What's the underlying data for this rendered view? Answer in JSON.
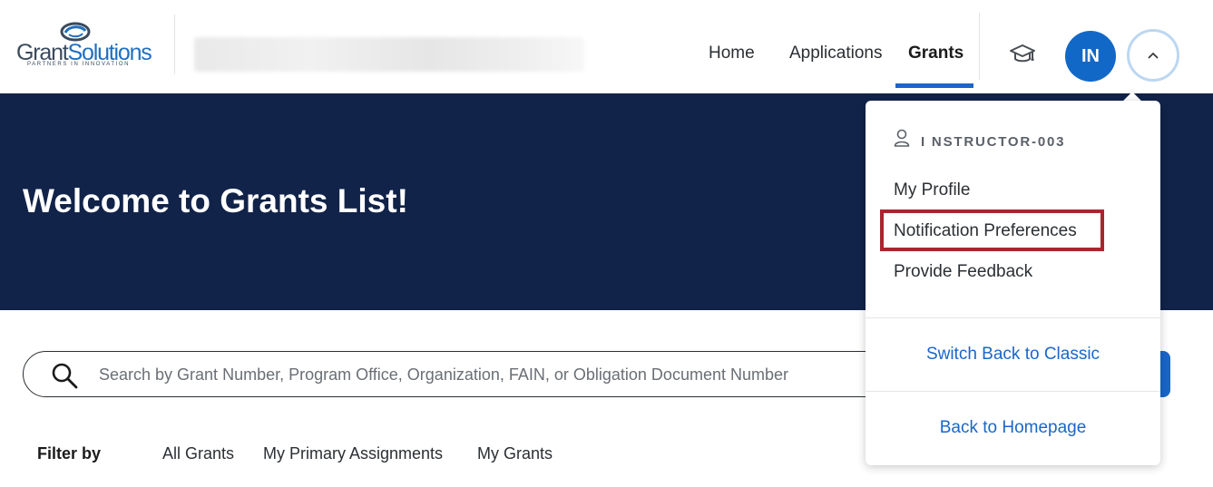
{
  "brand": {
    "logo_part1": "Grant",
    "logo_part2": "Solutions",
    "logo_tagline": "PARTNERS IN INNOVATION",
    "accent_color": "#1a66c9",
    "hero_color": "#112349"
  },
  "nav": {
    "items": [
      {
        "label": "Home"
      },
      {
        "label": "Applications"
      },
      {
        "label": "Grants",
        "active": true
      }
    ],
    "training_icon": "graduation-cap-icon",
    "avatar_initials": "IN",
    "menu_toggle_icon": "chevron-up-icon"
  },
  "hero": {
    "title": "Welcome to Grants List!"
  },
  "search": {
    "placeholder": "Search by Grant Number, Program Office, Organization, FAIN, or Obligation Document Number",
    "value": "",
    "icon": "search-icon"
  },
  "filter": {
    "label": "Filter by",
    "options": [
      "All Grants",
      "My Primary Assignments",
      "My Grants"
    ]
  },
  "user_menu": {
    "username": "I NSTRUCTOR-003",
    "user_icon": "person-icon",
    "items": [
      "My Profile",
      "Notification Preferences",
      "Provide Feedback"
    ],
    "highlighted_item": "Notification Preferences",
    "highlight_color": "#a8262e",
    "links": [
      "Switch Back to Classic",
      "Back to Homepage"
    ]
  }
}
